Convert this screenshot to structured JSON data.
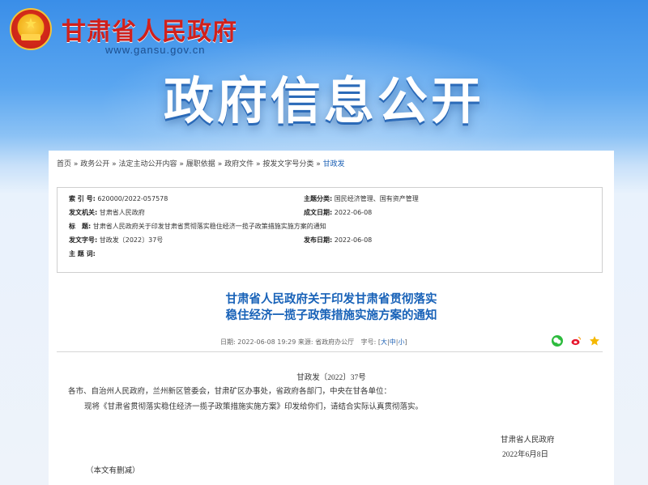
{
  "header": {
    "site_title": "甘肃省人民政府",
    "site_url": "www.gansu.gov.cn",
    "banner_title": "政府信息公开"
  },
  "breadcrumb": [
    "首页",
    "政务公开",
    "法定主动公开内容",
    "履职依据",
    "政府文件",
    "按发文字号分类",
    "甘政发"
  ],
  "meta": {
    "index_label": "索 引 号:",
    "index_value": "620000/2022-057578",
    "topic_label": "主题分类:",
    "topic_value": "国民经济管理、国有资产管理",
    "issuer_label": "发文机关:",
    "issuer_value": "甘肃省人民政府",
    "created_label": "成文日期:",
    "created_value": "2022-06-08",
    "title_label": "标　题:",
    "title_value": "甘肃省人民政府关于印发甘肃省贯彻落实稳住经济一揽子政策措施实施方案的通知",
    "docno_label": "发文字号:",
    "docno_value": "甘政发〔2022〕37号",
    "published_label": "发布日期:",
    "published_value": "2022-06-08",
    "keywords_label": "主 题 词:",
    "keywords_value": ""
  },
  "article": {
    "title_line1": "甘肃省人民政府关于印发甘肃省贯彻落实",
    "title_line2": "稳住经济一揽子政策措施实施方案的通知",
    "date_text": "日期: 2022-06-08 19:29",
    "source_text": "来源: 省政府办公厅",
    "font_label": "字号:",
    "size_large": "大",
    "size_medium": "中",
    "size_small": "小",
    "doc_number": "甘政发〔2022〕37号",
    "recipients": "各市、自治州人民政府，兰州新区管委会，甘肃矿区办事处，省政府各部门，中央在甘各单位：",
    "body": "现将《甘肃省贯彻落实稳住经济一揽子政策措施实施方案》印发给你们，请结合实际认真贯彻落实。",
    "signature": "甘肃省人民政府",
    "sign_date": "2022年6月8日",
    "note": "（本文有删减）"
  },
  "share_icons": [
    "wechat-icon",
    "weibo-icon",
    "favorite-icon"
  ],
  "colors": {
    "brand_red": "#d0201c",
    "link_blue": "#1a5fb4",
    "title_blue": "#1862b8"
  }
}
